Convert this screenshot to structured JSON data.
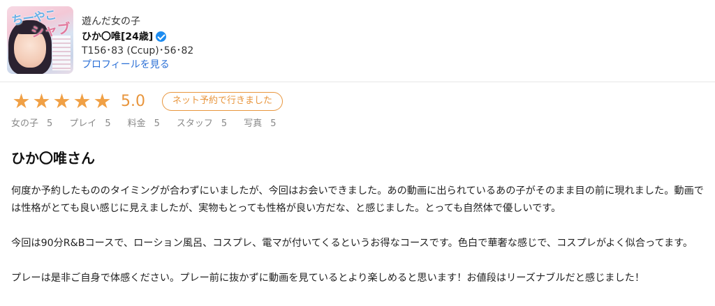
{
  "girl": {
    "label": "遊んだ女の子",
    "name": "ひか〇唯[24歳]",
    "spec": "T156･83 (Ccup)･56･82",
    "profile_link": "プロフィールを見る",
    "avatar_text_1": "ちーやこ",
    "avatar_text_2": "シャブ"
  },
  "rating": {
    "score": "5.0",
    "stars": 5,
    "visit_type": "ネット予約で行きました",
    "star_color": "#f0a045"
  },
  "sub_ratings": [
    {
      "label": "女の子",
      "value": "5"
    },
    {
      "label": "プレイ",
      "value": "5"
    },
    {
      "label": "料金",
      "value": "5"
    },
    {
      "label": "スタッフ",
      "value": "5"
    },
    {
      "label": "写真",
      "value": "5"
    }
  ],
  "review": {
    "title": "ひか〇唯さん",
    "paragraphs": [
      "何度か予約したもののタイミングが合わずにいましたが、今回はお会いできました。あの動画に出られているあの子がそのまま目の前に現れました。動画では性格がとても良い感じに見えましたが、実物もとっても性格が良い方だな、と感じました。とっても自然体で優しいです。",
      "今回は90分R&Bコースで、ローション風呂、コスプレ、電マが付いてくるというお得なコースです。色白で華奢な感じで、コスプレがよく似合ってます。",
      "プレーは是非ご自身で体感ください。プレー前に抜かずに動画を見ているとより楽しめると思います！お値段はリーズナブルだと感じました！"
    ]
  }
}
